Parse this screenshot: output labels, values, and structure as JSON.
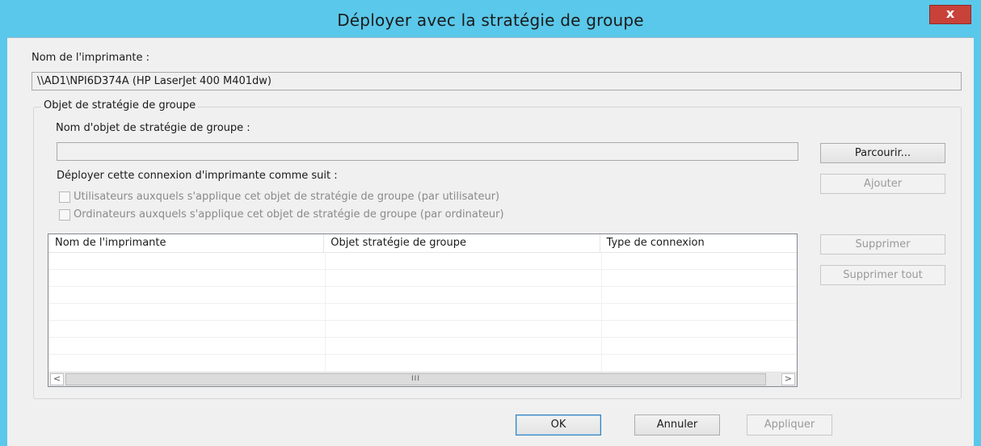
{
  "window": {
    "title": "Déployer avec la stratégie de groupe",
    "close_label": "x"
  },
  "printer": {
    "label": "Nom de l'imprimante :",
    "value": "\\\\AD1\\NPI6D374A (HP LaserJet 400 M401dw)"
  },
  "gpo_group": {
    "legend": "Objet de stratégie de groupe",
    "name_label": "Nom d'objet de stratégie de groupe :",
    "name_value": "",
    "browse_label": "Parcourir...",
    "add_label": "Ajouter",
    "deploy_label": "Déployer cette connexion d'imprimante comme suit :",
    "checkbox_users": "Utilisateurs auxquels s'applique cet objet de stratégie de groupe (par utilisateur)",
    "checkbox_computers": "Ordinateurs auxquels s'applique cet objet de stratégie de groupe (par ordinateur)",
    "checkbox_users_checked": false,
    "checkbox_computers_checked": false,
    "remove_label": "Supprimer",
    "remove_all_label": "Supprimer tout"
  },
  "table": {
    "columns": [
      "Nom de l'imprimante",
      "Objet stratégie de groupe",
      "Type de connexion"
    ],
    "rows": [],
    "scroll_left": "<",
    "scroll_right": ">",
    "scroll_thumb": "III"
  },
  "footer": {
    "ok_label": "OK",
    "cancel_label": "Annuler",
    "apply_label": "Appliquer"
  },
  "colors": {
    "title_bar": "#5ac8ea",
    "close_button": "#c8423a",
    "dialog_bg": "#f0f0f0"
  },
  "icons": {
    "close": "close-icon",
    "scroll_left": "chevron-left-icon",
    "scroll_right": "chevron-right-icon"
  }
}
